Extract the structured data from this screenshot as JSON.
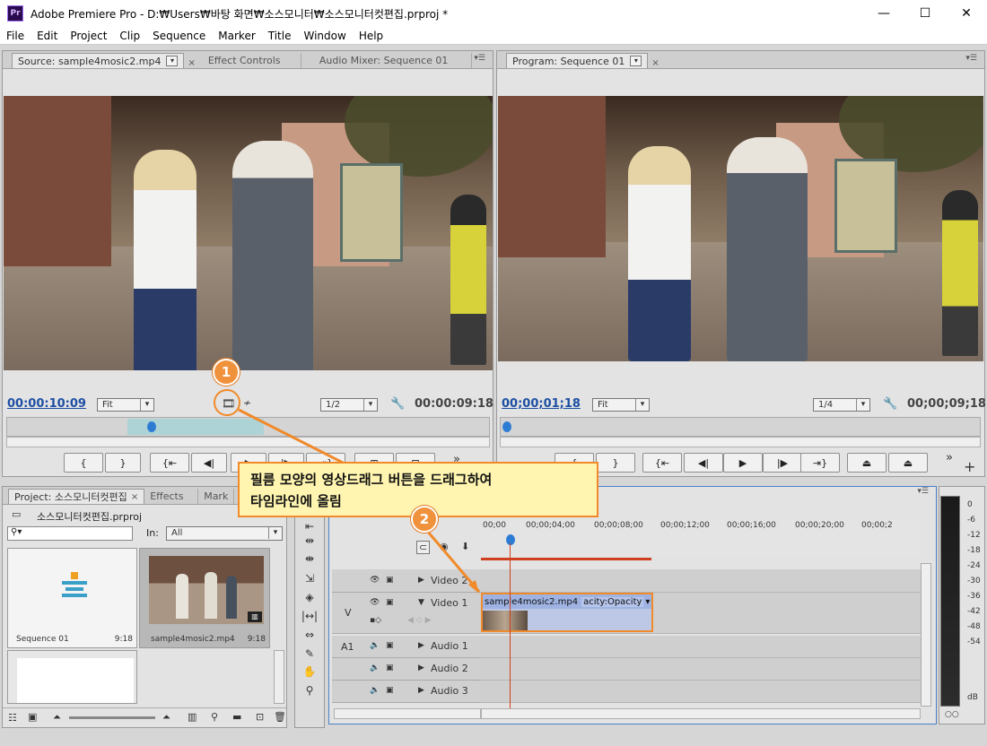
{
  "window": {
    "app_icon": "Pr",
    "title": "Adobe Premiere Pro - D:₩Users₩바탕 화면₩소스모니터₩소스모니터컷편집.prproj *",
    "controls": [
      "minimize-icon",
      "maximize-icon",
      "close-icon"
    ]
  },
  "menu": [
    "File",
    "Edit",
    "Project",
    "Clip",
    "Sequence",
    "Marker",
    "Title",
    "Window",
    "Help"
  ],
  "source_panel": {
    "tabs": [
      "Source: sample4mosic2.mp4",
      "Effect Controls",
      "Audio Mixer: Sequence 01"
    ],
    "timecode_current": "00:00:10:09",
    "zoom": "Fit",
    "resolution": "1/2",
    "timecode_duration": "00:00:09:18"
  },
  "program_panel": {
    "tabs": [
      "Program: Sequence 01"
    ],
    "timecode_current": "00;00;01;18",
    "zoom": "Fit",
    "resolution": "1/4",
    "timecode_duration": "00;00;09;18"
  },
  "callout": {
    "step1": "1",
    "step2": "2",
    "text_line1": "필름 모양의 영상드래그 버튼을 드래그하여",
    "text_line2": "타임라인에 올림"
  },
  "project_panel": {
    "tabs": [
      "Project: 소스모니터컷편집",
      "Effects",
      "Mark"
    ],
    "project_file": "소스모니터컷편집.prproj",
    "in_label": "In:",
    "in_value": "All",
    "items": [
      {
        "name": "Sequence 01",
        "duration": "9:18"
      },
      {
        "name": "sample4mosic2.mp4",
        "duration": "9:18"
      }
    ]
  },
  "timeline": {
    "ruler_labels": [
      "00;00",
      "00;00;04;00",
      "00;00;08;00",
      "00;00;12;00",
      "00;00;16;00",
      "00;00;20;00",
      "00;00;2"
    ],
    "tracks": {
      "video2": "Video 2",
      "video1": "Video 1",
      "v_marker": "V",
      "a_marker": "A1",
      "audio1": "Audio 1",
      "audio2": "Audio 2",
      "audio3": "Audio 3"
    },
    "clip_name": "sample4mosic2.mp4",
    "clip_effect": "acity:Opacity"
  },
  "meter": {
    "labels": [
      "0",
      "-6",
      "-12",
      "-18",
      "-24",
      "-30",
      "-36",
      "-42",
      "-48",
      "-54",
      "dB"
    ]
  },
  "colors": {
    "accent_orange": "#f08a2a",
    "callout_fill": "#fff5b0",
    "timecode_blue": "#1e4fa3",
    "playhead_red": "#d04020"
  }
}
